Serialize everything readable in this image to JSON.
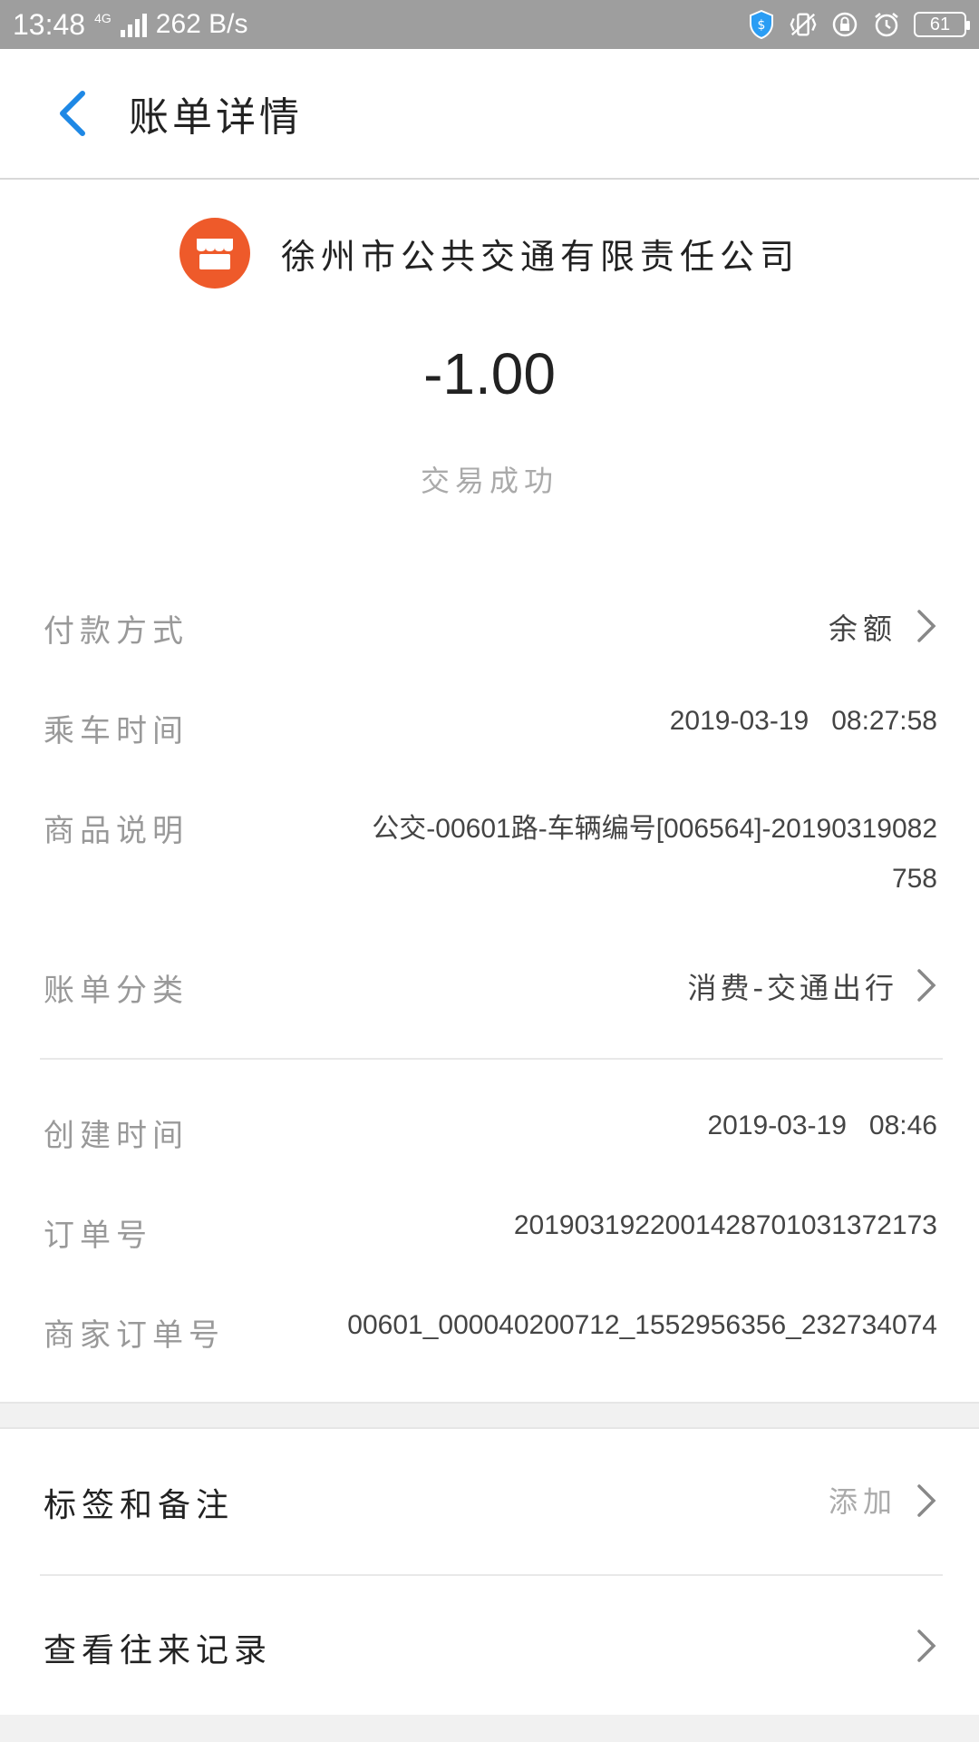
{
  "status_bar": {
    "time": "13:48",
    "network": "4G",
    "speed": "262 B/s",
    "battery": "61"
  },
  "header": {
    "title": "账单详情"
  },
  "summary": {
    "merchant_name": "徐州市公共交通有限责任公司",
    "amount": "-1.00",
    "status": "交易成功"
  },
  "details": {
    "payment_method": {
      "label": "付款方式",
      "value": "余额"
    },
    "ride_time": {
      "label": "乘车时间",
      "value": "2019-03-19   08:27:58"
    },
    "product_desc": {
      "label": "商品说明",
      "value_line1": "公交-00601路-车辆编号[006564]-20190319082",
      "value_line2": "758"
    },
    "category": {
      "label": "账单分类",
      "value": "消费-交通出行"
    },
    "created_time": {
      "label": "创建时间",
      "value": "2019-03-19   08:46"
    },
    "order_no": {
      "label": "订单号",
      "value": "2019031922001428701031372173"
    },
    "merchant_order_no": {
      "label": "商家订单号",
      "value": "00601_000040200712_1552956356_232734074"
    }
  },
  "actions": {
    "tags_notes": {
      "label": "标签和备注",
      "value": "添加"
    },
    "history": {
      "label": "查看往来记录"
    }
  },
  "colors": {
    "accent": "#1e88e5",
    "merchant_logo": "#ee5a2a",
    "status_bar": "#9e9e9e"
  }
}
